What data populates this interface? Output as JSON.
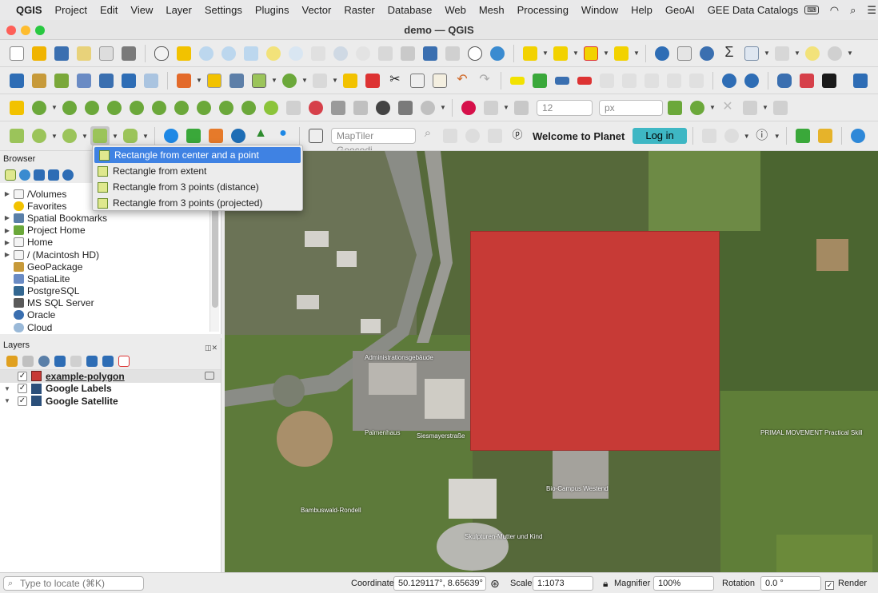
{
  "menubar": {
    "app": "QGIS",
    "items": [
      "Project",
      "Edit",
      "View",
      "Layer",
      "Settings",
      "Plugins",
      "Vector",
      "Raster",
      "Database",
      "Web",
      "Mesh",
      "Processing",
      "Window",
      "Help",
      "GeoAI",
      "GEE Data Catalogs"
    ]
  },
  "window": {
    "title": "demo — QGIS"
  },
  "toolbar": {
    "font_size_value": "12",
    "font_unit": "px",
    "geocoder_placeholder": "MapTiler Geocodi...",
    "welcome_text": "Welcome to Planet",
    "login_label": "Log in"
  },
  "dropdown": {
    "items": [
      "Rectangle from center and a point",
      "Rectangle from extent",
      "Rectangle from 3 points (distance)",
      "Rectangle from 3 points (projected)"
    ]
  },
  "browser": {
    "title": "Browser",
    "items": [
      "/Volumes",
      "Favorites",
      "Spatial Bookmarks",
      "Project Home",
      "Home",
      "/ (Macintosh HD)",
      "GeoPackage",
      "SpatiaLite",
      "PostgreSQL",
      "MS SQL Server",
      "Oracle",
      "Cloud"
    ]
  },
  "layers": {
    "title": "Layers",
    "items": [
      "example-polygon",
      "Google Labels",
      "Google Satellite"
    ]
  },
  "map_labels": {
    "l1": "Administrationsgebäude",
    "l2": "Bio-Campus Westend",
    "l3": "PRIMAL MOVEMENT Practical Skill",
    "l4": "Skulpturen-Mutter und Kind",
    "l5": "Bambuswald-Rondell",
    "l6": "Siesmayerstraße",
    "l7": "Palmenhaus"
  },
  "status": {
    "locate_placeholder": "Type to locate (⌘K)",
    "coordinate_label": "Coordinate",
    "coordinate_value": "50.129117°, 8.65639°",
    "scale_label": "Scale",
    "scale_value": "1:1073",
    "magnifier_label": "Magnifier",
    "magnifier_value": "100%",
    "rotation_label": "Rotation",
    "rotation_value": "0.0 °",
    "render_label": "Render"
  },
  "colors": {
    "polygon_fill": "#c73a36",
    "highlight": "#3f82e3",
    "login_bg": "#3eb7c4"
  }
}
